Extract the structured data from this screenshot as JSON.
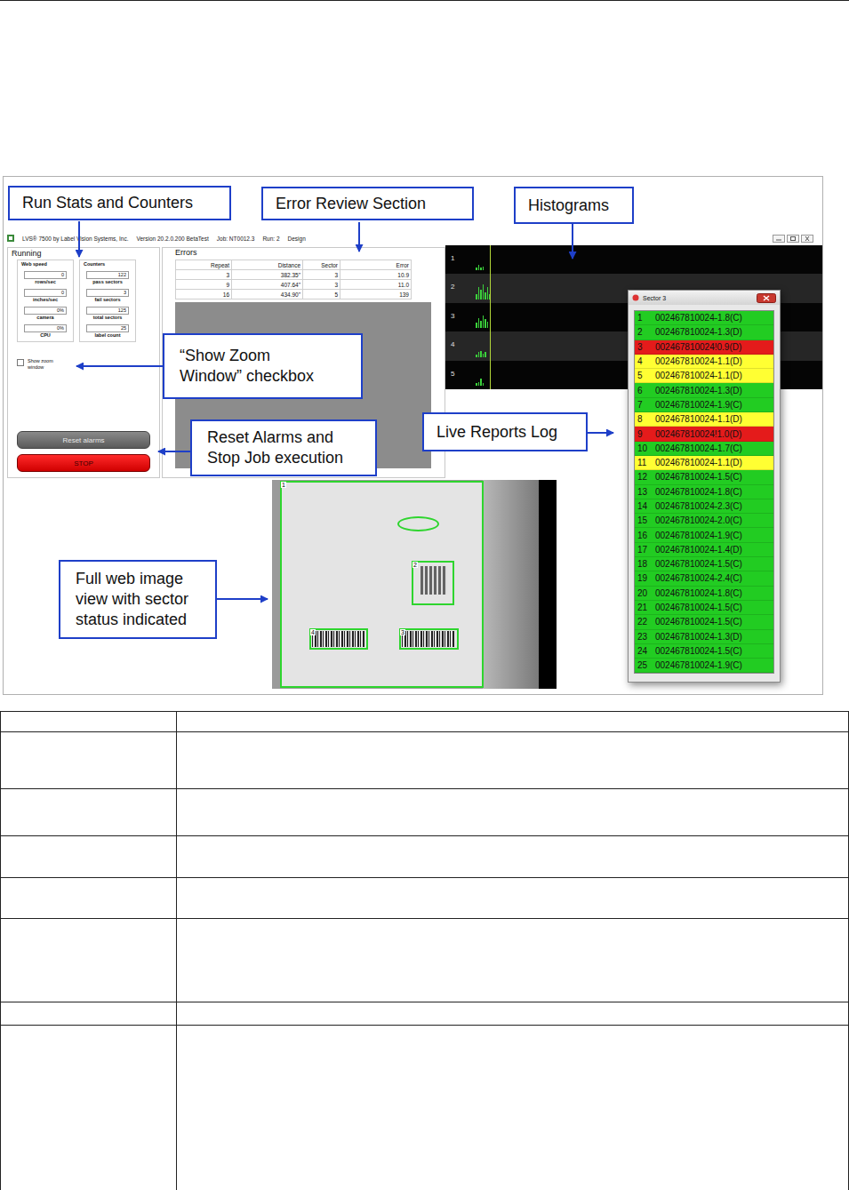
{
  "callouts": [
    {
      "lines": [
        "Run Stats and Counters"
      ]
    },
    {
      "lines": [
        "Error Review Section"
      ]
    },
    {
      "lines": [
        "Histograms"
      ]
    },
    {
      "lines": [
        "“Show Zoom",
        "Window” checkbox"
      ]
    },
    {
      "lines": [
        "Reset Alarms and",
        "Stop Job execution"
      ]
    },
    {
      "lines": [
        "Live Reports Log"
      ]
    },
    {
      "lines": [
        "Full web image",
        "view with sector",
        "status indicated"
      ]
    }
  ],
  "app": {
    "title_parts": [
      "LVS® 7500 by Label Vision Systems, Inc.",
      "Version 20.2.0.200 BetaTest",
      "Job: NT0012.3",
      "Run: 2",
      "Design"
    ]
  },
  "running": {
    "title": "Running",
    "groups": [
      {
        "title": "Web speed",
        "fields": [
          {
            "value": "0",
            "label": "rows/sec"
          },
          {
            "value": "0",
            "label": "inches/sec"
          },
          {
            "value": "0%",
            "label": "camera"
          },
          {
            "value": "0%",
            "label": "CPU"
          }
        ]
      },
      {
        "title": "Counters",
        "fields": [
          {
            "value": "122",
            "label": "pass sectors"
          },
          {
            "value": "3",
            "label": "fail sectors"
          },
          {
            "value": "125",
            "label": "total sectors"
          },
          {
            "value": "25",
            "label": "label count"
          }
        ]
      }
    ]
  },
  "zoom_checkbox": {
    "label": "Show zoom window",
    "checked": false
  },
  "buttons": [
    {
      "label": "Reset alarms",
      "kind": "reset"
    },
    {
      "label": "STOP",
      "kind": "stop"
    }
  ],
  "errors": {
    "title": "Errors",
    "columns": [
      "Repeat",
      "Distance",
      "Sector",
      "Error"
    ],
    "rows": [
      [
        "3",
        "382.35\"",
        "3",
        "10.9"
      ],
      [
        "9",
        "407.64\"",
        "3",
        "11.0"
      ],
      [
        "16",
        "434.90\"",
        "5",
        "139"
      ]
    ]
  },
  "histograms": [
    {
      "label": "1",
      "values": [
        0.1,
        0.2,
        0.1,
        0.15
      ]
    },
    {
      "label": "2",
      "values": [
        0.2,
        0.5,
        0.4,
        0.6,
        0.3,
        0.5,
        0.2
      ]
    },
    {
      "label": "3",
      "values": [
        0.2,
        0.4,
        0.3,
        0.5,
        0.35,
        0.25
      ]
    },
    {
      "label": "4",
      "values": [
        0.1,
        0.2,
        0.25,
        0.15,
        0.2
      ]
    },
    {
      "label": "5",
      "values": [
        0.1,
        0.15,
        0.3,
        0.1
      ]
    }
  ],
  "sector_window": {
    "title": "Sector 3",
    "rows": [
      {
        "index": "1",
        "text": "002467810024-1.8(C)",
        "color": "#22cc22"
      },
      {
        "index": "2",
        "text": "002467810024-1.3(D)",
        "color": "#22cc22"
      },
      {
        "index": "3",
        "text": "002467810024!0.9(D)",
        "color": "#e41b1b"
      },
      {
        "index": "4",
        "text": "002467810024-1.1(D)",
        "color": "#ffff33"
      },
      {
        "index": "5",
        "text": "002467810024-1.1(D)",
        "color": "#ffff33"
      },
      {
        "index": "6",
        "text": "002467810024-1.3(D)",
        "color": "#22cc22"
      },
      {
        "index": "7",
        "text": "002467810024-1.9(C)",
        "color": "#22cc22"
      },
      {
        "index": "8",
        "text": "002467810024-1.1(D)",
        "color": "#ffff33"
      },
      {
        "index": "9",
        "text": "002467810024!1.0(D)",
        "color": "#e41b1b"
      },
      {
        "index": "10",
        "text": "002467810024-1.7(C)",
        "color": "#22cc22"
      },
      {
        "index": "11",
        "text": "002467810024-1.1(D)",
        "color": "#ffff33"
      },
      {
        "index": "12",
        "text": "002467810024-1.5(C)",
        "color": "#22cc22"
      },
      {
        "index": "13",
        "text": "002467810024-1.8(C)",
        "color": "#22cc22"
      },
      {
        "index": "14",
        "text": "002467810024-2.3(C)",
        "color": "#22cc22"
      },
      {
        "index": "15",
        "text": "002467810024-2.0(C)",
        "color": "#22cc22"
      },
      {
        "index": "16",
        "text": "002467810024-1.9(C)",
        "color": "#22cc22"
      },
      {
        "index": "17",
        "text": "002467810024-1.4(D)",
        "color": "#22cc22"
      },
      {
        "index": "18",
        "text": "002467810024-1.5(C)",
        "color": "#22cc22"
      },
      {
        "index": "19",
        "text": "002467810024-2.4(C)",
        "color": "#22cc22"
      },
      {
        "index": "20",
        "text": "002467810024-1.8(C)",
        "color": "#22cc22"
      },
      {
        "index": "21",
        "text": "002467810024-1.5(C)",
        "color": "#22cc22"
      },
      {
        "index": "22",
        "text": "002467810024-1.5(C)",
        "color": "#22cc22"
      },
      {
        "index": "23",
        "text": "002467810024-1.3(D)",
        "color": "#22cc22"
      },
      {
        "index": "24",
        "text": "002467810024-1.5(C)",
        "color": "#22cc22"
      },
      {
        "index": "25",
        "text": "002467810024-1.9(C)",
        "color": "#22cc22"
      }
    ]
  },
  "web_image": {
    "sectors": [
      {
        "label": "1",
        "kind": "box",
        "color": "#2ed52e"
      },
      {
        "label": "2",
        "kind": "box",
        "color": "#2ed52e"
      },
      {
        "label": "3",
        "kind": "box",
        "color": "#2ed52e"
      },
      {
        "label": "4",
        "kind": "box",
        "color": "#2ed52e"
      },
      {
        "label": "",
        "kind": "ellipse",
        "color": "#2ed52e"
      }
    ]
  },
  "doc_table": {
    "rows": [
      {
        "cells": [
          "",
          ""
        ]
      },
      {
        "cells": [
          "",
          ""
        ]
      },
      {
        "cells": [
          "",
          ""
        ]
      },
      {
        "cells": [
          "",
          ""
        ]
      },
      {
        "cells": [
          "",
          ""
        ]
      },
      {
        "cells": [
          "",
          ""
        ]
      },
      {
        "cells": [
          "",
          ""
        ]
      },
      {
        "cells": [
          "",
          ""
        ]
      }
    ]
  }
}
